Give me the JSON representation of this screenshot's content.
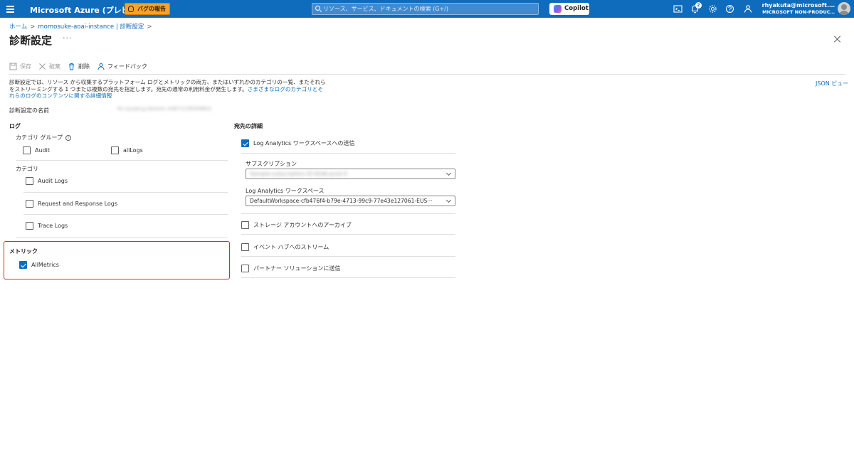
{
  "topbar": {
    "brand": "Microsoft Azure (プレビュー)",
    "bug_report": "バグの報告",
    "search_placeholder": "リソース、サービス、ドキュメントの検索 (G+/)",
    "copilot": "Copilot",
    "notification_count": "2",
    "account_email": "rhyakuta@microsoft.…",
    "account_tenant": "MICROSOFT NON-PRODUC…"
  },
  "breadcrumb": {
    "home": "ホーム",
    "resource": "momosuke-aoai-instance | 診断設定"
  },
  "page": {
    "title": "診断設定",
    "more": "···"
  },
  "toolbar": {
    "save": "保存",
    "discard": "破棄",
    "delete": "削除",
    "feedback": "フィードバック"
  },
  "description": {
    "text": "診断設定では、リソース から収集するプラットフォーム ログとメトリックの両方、またはいずれかのカテゴリの一覧、またそれらをストリーミングする 1 つまたは複数の宛先を指定します。宛先の通常の利用料金が発生します。",
    "link": "さまざまなログのカテゴリとそれらのログのコンテンツに関する詳細情報"
  },
  "json_view": "JSON ビュー",
  "setting_name": {
    "label": "診断設定の名前",
    "value": "lkl.xyzabcg.datarec-49871236589601"
  },
  "logs": {
    "heading": "ログ",
    "category_groups_label": "カテゴリ グループ",
    "category_groups": [
      {
        "label": "Audit",
        "checked": false
      },
      {
        "label": "allLogs",
        "checked": false
      }
    ],
    "categories_label": "カテゴリ",
    "categories": [
      {
        "label": "Audit Logs",
        "checked": false
      },
      {
        "label": "Request and Response Logs",
        "checked": false
      },
      {
        "label": "Trace Logs",
        "checked": false
      }
    ]
  },
  "metrics": {
    "heading": "メトリック",
    "items": [
      {
        "label": "AllMetrics",
        "checked": true
      }
    ]
  },
  "destination": {
    "heading": "宛先の詳細",
    "log_analytics": {
      "label": "Log Analytics ワークスペースへの送信",
      "checked": true
    },
    "subscription_label": "サブスクリプション",
    "subscription_value": "Sample-subscription-ID-AOAI-prod-4",
    "workspace_label": "Log Analytics ワークスペース",
    "workspace_value": "DefaultWorkspace-cfb476f4-b79e-4713-99c9-77e43e127061-EUS···",
    "options": [
      {
        "label": "ストレージ アカウントへのアーカイブ",
        "checked": false
      },
      {
        "label": "イベント ハブへのストリーム",
        "checked": false
      },
      {
        "label": "パートナー ソリューションに送信",
        "checked": false
      }
    ]
  },
  "colors": {
    "accent": "#0f6cbd",
    "highlight_border": "#e8222a",
    "bug_button": "#f7a32a"
  }
}
